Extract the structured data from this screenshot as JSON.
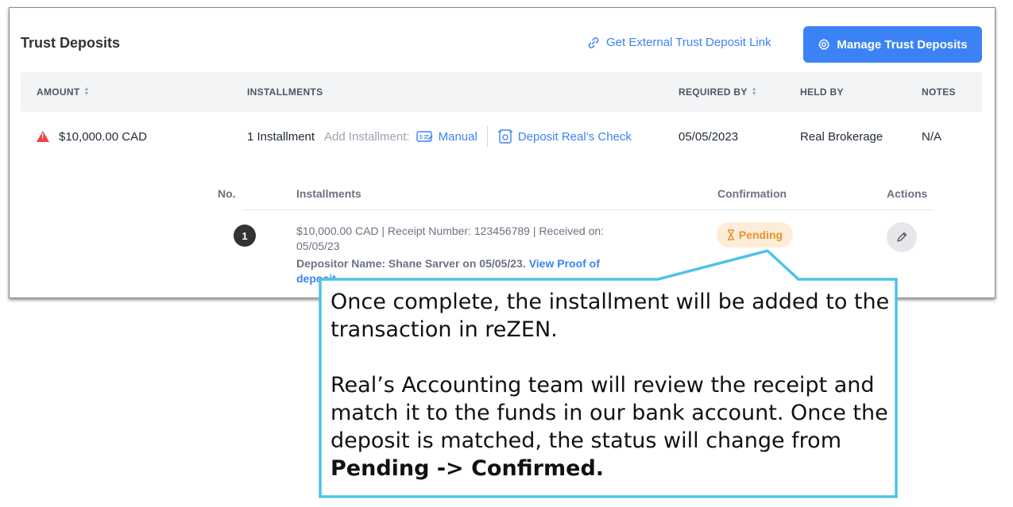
{
  "panel": {
    "title": "Trust Deposits",
    "external_link": "Get External Trust Deposit Link",
    "manage_button": "Manage Trust Deposits"
  },
  "table": {
    "headers": {
      "amount": "AMOUNT",
      "installments": "INSTALLMENTS",
      "required_by": "REQUIRED BY",
      "held_by": "HELD BY",
      "notes": "NOTES"
    },
    "row": {
      "amount": "$10,000.00 CAD",
      "installment_count": "1 Installment",
      "add_installment_label": "Add Installment:",
      "manual": "Manual",
      "deposit_check": "Deposit Real’s Check",
      "required_by": "05/05/2023",
      "held_by": "Real Brokerage",
      "notes": "N/A"
    }
  },
  "installments": {
    "headers": {
      "no": "No.",
      "installments": "Installments",
      "confirmation": "Confirmation",
      "actions": "Actions"
    },
    "items": [
      {
        "number": "1",
        "details": "$10,000.00 CAD | Receipt Number: 123456789 | Received on: 05/05/23",
        "depositor": "Depositor Name: Shane Sarver on 05/05/23.",
        "proof_link": "View Proof of deposit",
        "status": "Pending"
      }
    ]
  },
  "callout": {
    "paragraph1": "Once complete, the installment will be added to the transaction in reZEN.",
    "paragraph2": "Real’s Accounting team will review the receipt and match it to the funds in our bank account. Once the deposit is matched, the status will change from",
    "emphasis": "Pending -> Confirmed.",
    "border_color": "#4dc3e8"
  }
}
